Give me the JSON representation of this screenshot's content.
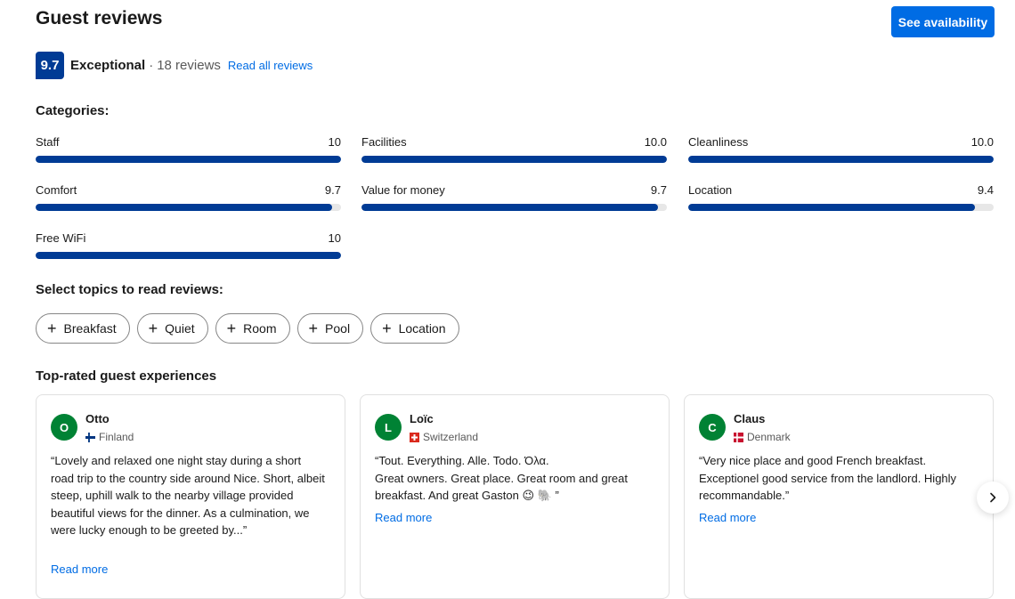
{
  "header": {
    "title": "Guest reviews",
    "cta_label": "See availability"
  },
  "score": {
    "value": "9.7",
    "word": "Exceptional",
    "separator": "·",
    "count_text": "18 reviews",
    "read_all_label": "Read all reviews"
  },
  "categories": {
    "heading": "Categories:",
    "items": [
      {
        "label": "Staff",
        "value": "10",
        "fraction": 1.0
      },
      {
        "label": "Facilities",
        "value": "10.0",
        "fraction": 1.0
      },
      {
        "label": "Cleanliness",
        "value": "10.0",
        "fraction": 1.0
      },
      {
        "label": "Comfort",
        "value": "9.7",
        "fraction": 0.97
      },
      {
        "label": "Value for money",
        "value": "9.7",
        "fraction": 0.97
      },
      {
        "label": "Location",
        "value": "9.4",
        "fraction": 0.94
      },
      {
        "label": "Free WiFi",
        "value": "10",
        "fraction": 1.0
      }
    ]
  },
  "topics": {
    "heading": "Select topics to read reviews:",
    "chips": [
      {
        "plus": "+",
        "label": "Breakfast"
      },
      {
        "plus": "+",
        "label": "Quiet"
      },
      {
        "plus": "+",
        "label": "Room"
      },
      {
        "plus": "+",
        "label": "Pool"
      },
      {
        "plus": "+",
        "label": "Location"
      }
    ]
  },
  "experiences": {
    "heading": "Top-rated guest experiences",
    "reviews": [
      {
        "initial": "O",
        "name": "Otto",
        "country": "Finland",
        "quote": "“Lovely and relaxed one night stay during a short road trip to the country side around Nice. Short, albeit steep, uphill walk to the nearby village provided beautiful views for the dinner. As a culmination, we were lucky enough to be greeted by...”",
        "read_more": "Read more"
      },
      {
        "initial": "L",
        "name": "Loïc",
        "country": "Switzerland",
        "quote": "“Tout. Everything. Alle. Todo. Όλα.\nGreat owners. Great place. Great room and great breakfast. And great Gaston 😉 🐘 ”",
        "read_more": "Read more"
      },
      {
        "initial": "C",
        "name": "Claus",
        "country": "Denmark",
        "quote": "“Very nice place and good French breakfast. Exceptionel good service from the landlord. Highly recommandable.”",
        "read_more": "Read more"
      }
    ]
  },
  "colors": {
    "brand": "#003b95",
    "action": "#006ce4",
    "avatar": "#008234",
    "link": "#006ce4"
  },
  "icons": {
    "next": "chevron-right-icon",
    "chip": "plus-icon"
  }
}
